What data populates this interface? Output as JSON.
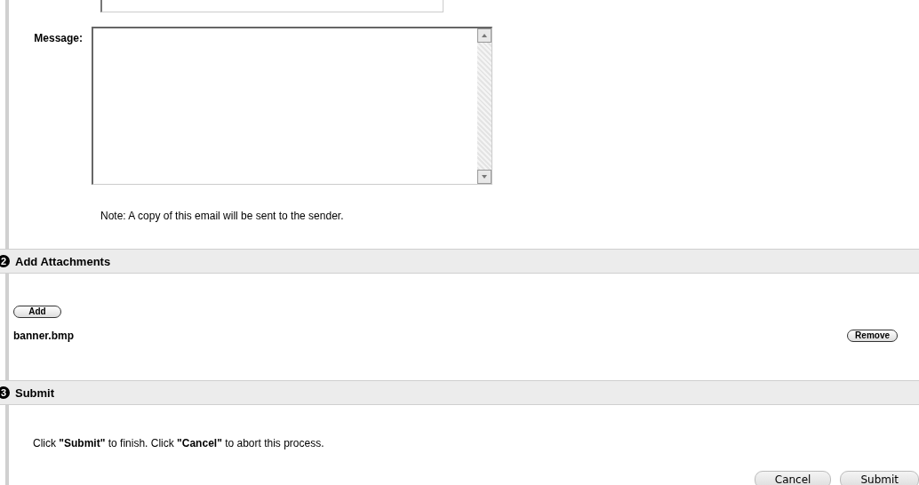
{
  "message": {
    "label": "Message:"
  },
  "note": "Note: A copy of this email will be sent to the sender.",
  "sections": [
    {
      "number": "2",
      "title": "Add Attachments"
    },
    {
      "number": "3",
      "title": "Submit"
    }
  ],
  "attachments": {
    "add_button": "Add",
    "files": [
      {
        "name": "banner.bmp",
        "remove_button": "Remove"
      }
    ]
  },
  "instructions": "Click **\"Submit\"** to finish. Click **\"Cancel\"** to abort this process.",
  "buttons": [
    "Cancel",
    "Submit"
  ]
}
